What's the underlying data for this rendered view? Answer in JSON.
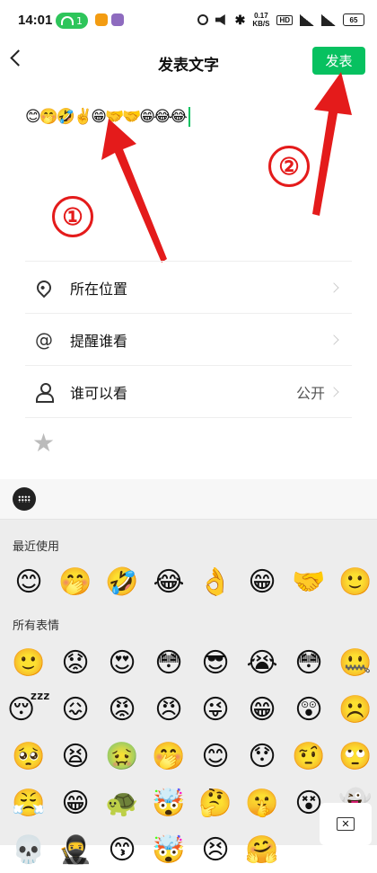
{
  "status_bar": {
    "time": "14:01",
    "pill_count": "1",
    "net_speed": "0.17",
    "net_unit": "KB/S",
    "hd": "HD",
    "sig1": "5G",
    "sig2": "5G",
    "battery": "65"
  },
  "header": {
    "title": "发表文字",
    "publish_label": "发表"
  },
  "compose": {
    "text": "😊🤭🤣✌️😁🤝🤝😁😂😂"
  },
  "annotations": {
    "one": "①",
    "two": "②",
    "color": "#e41b1b"
  },
  "options": {
    "location_label": "所在位置",
    "remind_label": "提醒谁看",
    "visibility_label": "谁可以看",
    "visibility_value": "公开"
  },
  "emoji_panel": {
    "recent_title": "最近使用",
    "all_title": "所有表情",
    "recent": [
      "😊",
      "🤭",
      "🤣",
      "😂",
      "👌",
      "😁",
      "🤝",
      "🙂"
    ],
    "all": [
      "🙂",
      "😟",
      "😍",
      "😳",
      "😎",
      "😭",
      "😳",
      "🤐",
      "😴",
      "😖",
      "😡",
      "😠",
      "😜",
      "😁",
      "😲",
      "☹️",
      "🥺",
      "😫",
      "🤢",
      "🤭",
      "😊",
      "😯",
      "🤨",
      "🙄",
      "😤",
      "😁",
      "🐢",
      "🤯",
      "🤔",
      "🤫",
      "😵",
      "👻",
      "💀",
      "🥷",
      "😙",
      "🤯",
      "😣",
      "🤗",
      "",
      ""
    ]
  },
  "colors": {
    "accent": "#07c160",
    "panel_bg": "#ededed"
  }
}
